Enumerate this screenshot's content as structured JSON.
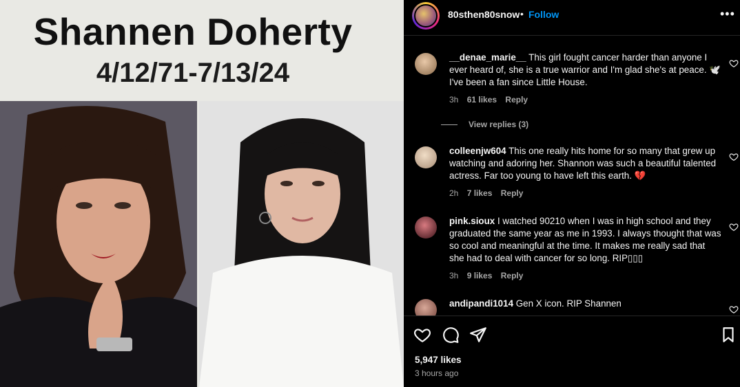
{
  "image": {
    "title": "Shannen Doherty",
    "dates": "4/12/71-7/13/24"
  },
  "header": {
    "username": "80sthen80snow",
    "separator": "•",
    "follow_label": "Follow",
    "more_icon": "more-horizontal-icon"
  },
  "comments": [
    {
      "user": "__denae_marie__",
      "text": "This girl fought cancer harder than anyone I ever heard of, she is a true warrior and I'm glad she's at peace. 🕊️ I've been a fan since Little House.",
      "time": "3h",
      "likes": "61 likes",
      "reply": "Reply",
      "view_replies": "View replies (3)",
      "avatar_color": "#c9a27a"
    },
    {
      "user": "colleenjw604",
      "text": "This one really hits home for so many that grew up watching and adoring her. Shannon was such a beautiful talented actress. Far too young to have left this earth. 💔",
      "time": "2h",
      "likes": "7 likes",
      "reply": "Reply",
      "avatar_color": "#d8c2a8"
    },
    {
      "user": "pink.sioux",
      "text": "I watched 90210 when I was in high school and they graduated the same year as me in 1993. I always thought that was so cool and meaningful at the time. It makes me really sad that she had to deal with cancer for so long. RIP▯▯▯",
      "time": "3h",
      "likes": "9 likes",
      "reply": "Reply",
      "avatar_color": "#8a2a3a"
    },
    {
      "user": "andipandi1014",
      "text": "Gen X icon. RIP Shannen",
      "avatar_color": "#b07a6a"
    }
  ],
  "footer": {
    "likes": "5,947 likes",
    "posted": "3 hours ago"
  },
  "colors": {
    "accent": "#0095f6",
    "muted": "#a8a8a8",
    "background": "#000000"
  }
}
